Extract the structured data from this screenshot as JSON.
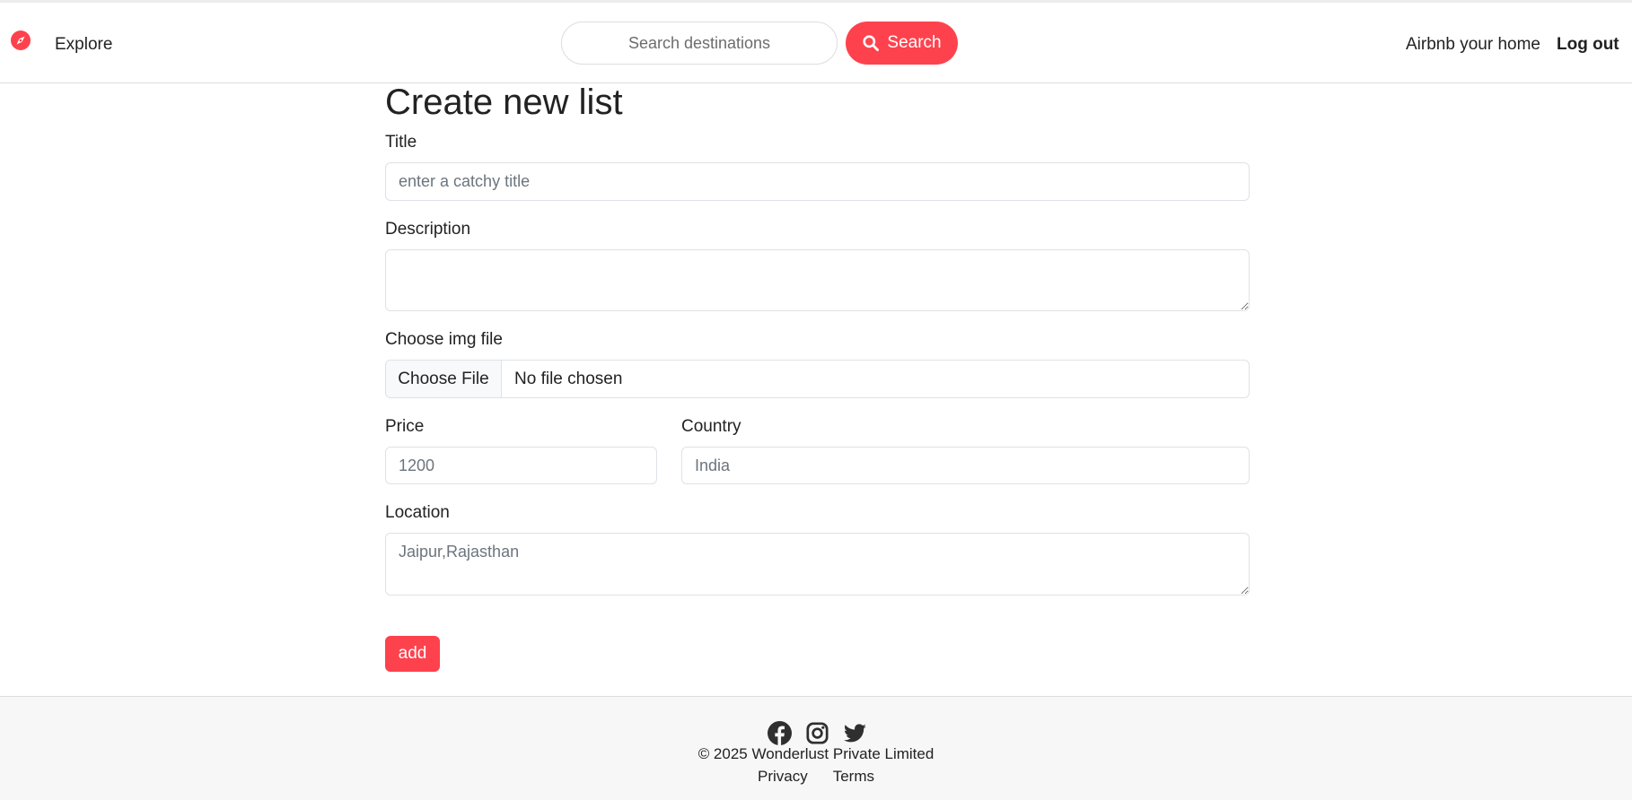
{
  "navbar": {
    "brand_icon": "compass-icon",
    "explore_label": "Explore",
    "search_placeholder": "Search destinations",
    "search_button_label": "Search",
    "host_link_label": "Airbnb your home",
    "logout_label": "Log out"
  },
  "form": {
    "heading": "Create new list",
    "title_label": "Title",
    "title_placeholder": "enter a catchy title",
    "description_label": "Description",
    "description_value": "",
    "image_label": "Choose img file",
    "file_button_label": "Choose File",
    "file_status": "No file chosen",
    "price_label": "Price",
    "price_placeholder": "1200",
    "country_label": "Country",
    "country_placeholder": "India",
    "location_label": "Location",
    "location_placeholder": "Jaipur,Rajasthan",
    "submit_label": "add"
  },
  "footer": {
    "social_icons": [
      "facebook-icon",
      "instagram-icon",
      "twitter-icon"
    ],
    "copyright": "© 2025 Wonderlust Private Limited",
    "privacy_label": "Privacy",
    "terms_label": "Terms"
  },
  "colors": {
    "accent": "#fe424d",
    "text": "#222222",
    "footer_bg": "#f7f7f7",
    "border": "#dee2e6"
  }
}
